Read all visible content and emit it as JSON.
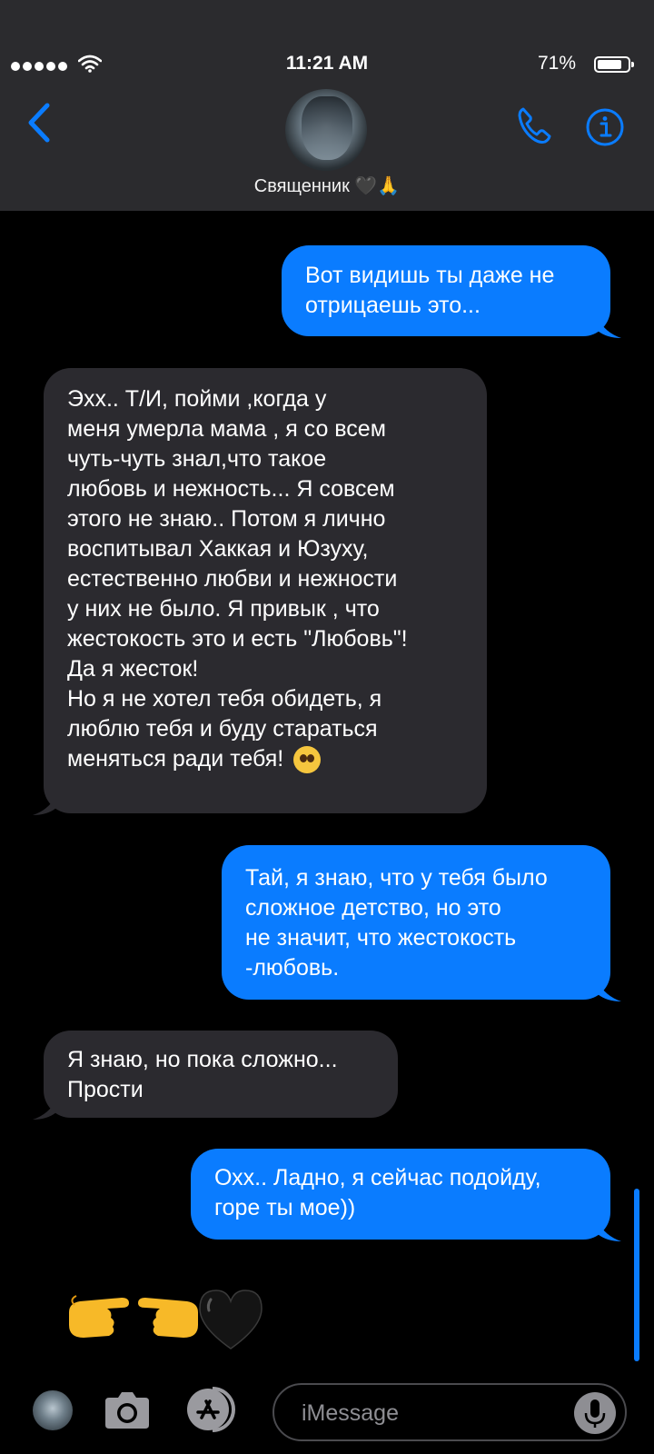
{
  "status_bar": {
    "time": "11:21 AM",
    "battery_percent": "71%",
    "battery_level": 0.71,
    "signal_bars": 5
  },
  "header": {
    "contact_name": "Священник 🖤🙏",
    "back_icon": "chevron-left-icon",
    "phone_icon": "phone-icon",
    "info_icon": "info-icon"
  },
  "messages": [
    {
      "side": "outgoing",
      "text": "Вот видишь ты даже не\nотрицаешь это..."
    },
    {
      "side": "incoming",
      "text": "Эхх.. Т/И, пойми ,когда у\nменя умерла мама , я со всем\nчуть-чуть знал,что такое\nлюбовь и нежность... Я совсем\nэтого не знаю.. Потом я лично\nвоспитывал  Хаккая и Юзуху,\nестественно любви и нежности\nу них не было. Я привык , что\nжестокость это и есть \"Любовь\"!\nДа я жесток!\nНо я не хотел тебя обидеть, я\nлюблю тебя и буду стараться\nменяться ради тебя!"
    },
    {
      "side": "outgoing",
      "text": "Тай, я знаю, что у  тебя было\nсложное детство, но это\nне значит, что  жестокость\n-любовь."
    },
    {
      "side": "incoming",
      "text": "Я знаю, но пока сложно...\nПрости"
    },
    {
      "side": "outgoing",
      "text": "Охх.. Ладно, я сейчас подойду,\nгоре ты мое))"
    },
    {
      "side": "outgoing",
      "emoji": "👉👈🖤"
    }
  ],
  "composer": {
    "placeholder": "iMessage",
    "camera_icon": "camera-icon",
    "appstore_icon": "app-store-icon",
    "mic_icon": "microphone-icon"
  },
  "colors": {
    "accent": "#0a7cff",
    "incoming_bubble": "#2b2a2f",
    "header_bg": "#2b2b2e",
    "background": "#000000"
  }
}
